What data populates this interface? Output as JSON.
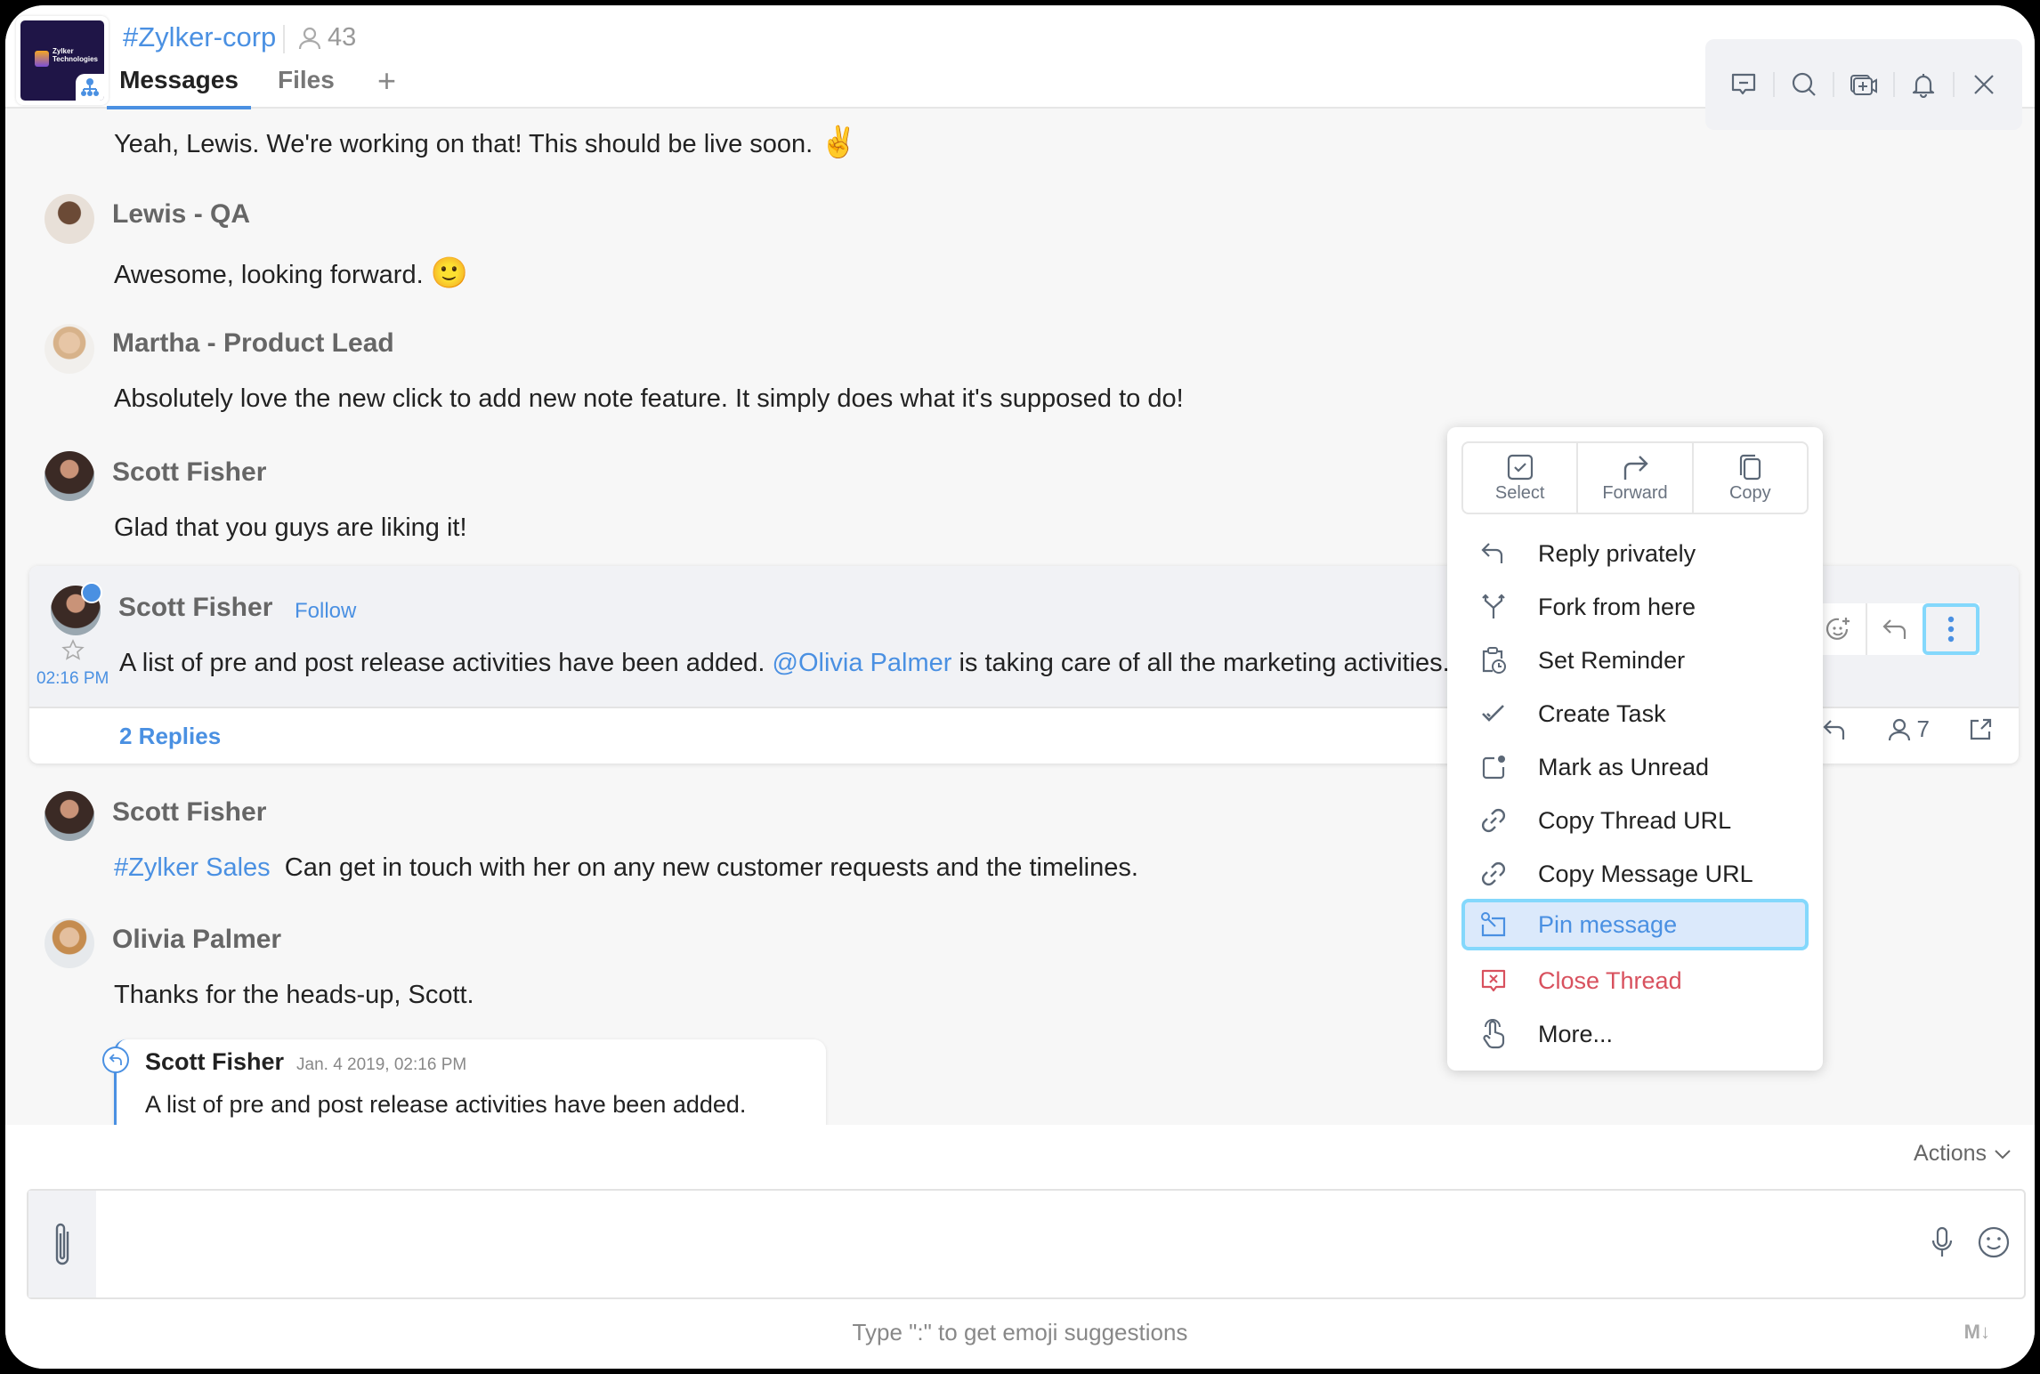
{
  "header": {
    "channel": "#Zylker-corp",
    "member_count": "43",
    "logo_text": "Zylker Technologies",
    "tabs": [
      {
        "label": "Messages",
        "active": true
      },
      {
        "label": "Files",
        "active": false
      }
    ],
    "add_tab_label": "+",
    "toolbar_icons": [
      "thread-icon",
      "search-icon",
      "add-video-icon",
      "bell-icon",
      "close-icon"
    ]
  },
  "messages": [
    {
      "author": "",
      "text": "Yeah, Lewis. We're working on that! This should be live soon.",
      "emoji": "✌️"
    },
    {
      "author": "Lewis - QA",
      "text": "Awesome, looking forward.",
      "emoji": "🙂"
    },
    {
      "author": "Martha - Product Lead",
      "text": "Absolutely love the new click to add new note feature. It simply does what it's supposed to do!"
    },
    {
      "author": "Scott Fisher",
      "text": "Glad that you guys are liking it!"
    }
  ],
  "thread": {
    "author": "Scott Fisher",
    "follow_label": "Follow",
    "time": "02:16 PM",
    "text_before": "A list of pre and post release activities have been added. ",
    "mention": "@Olivia Palmer",
    "text_after": " is taking care of all the marketing activities.",
    "replies_label": "2 Replies",
    "participants": "7"
  },
  "messages_after": [
    {
      "author": "Scott Fisher",
      "channel_link": "#Zylker Sales",
      "text": "Can get in touch with her on any new customer requests and the timelines."
    },
    {
      "author": "Olivia Palmer",
      "text": "Thanks for the heads-up, Scott."
    }
  ],
  "quote": {
    "author": "Scott Fisher",
    "date": "Jan. 4 2019, 02:16 PM",
    "text": "A list of pre and post release activities have been added."
  },
  "context_menu": {
    "top_actions": [
      {
        "label": "Select",
        "icon": "checkbox-icon"
      },
      {
        "label": "Forward",
        "icon": "forward-icon"
      },
      {
        "label": "Copy",
        "icon": "copy-icon"
      }
    ],
    "items": [
      {
        "label": "Reply privately",
        "icon": "reply-icon"
      },
      {
        "label": "Fork from here",
        "icon": "fork-icon"
      },
      {
        "label": "Set Reminder",
        "icon": "reminder-icon"
      },
      {
        "label": "Create Task",
        "icon": "task-icon"
      },
      {
        "label": "Mark as Unread",
        "icon": "unread-icon"
      },
      {
        "label": "Copy Thread URL",
        "icon": "link-icon"
      },
      {
        "label": "Copy Message URL",
        "icon": "link-icon"
      },
      {
        "label": "Pin message",
        "icon": "pin-icon",
        "highlighted": true
      },
      {
        "label": "Close Thread",
        "icon": "close-thread-icon",
        "danger": true
      },
      {
        "label": "More...",
        "icon": "hand-pointer-icon"
      }
    ]
  },
  "composer": {
    "actions_label": "Actions",
    "placeholder": "",
    "hint": "Type \":\" to get emoji suggestions",
    "markdown_label": "M↓"
  },
  "colors": {
    "accent": "#4a90e2",
    "highlight_border": "#84d8fc",
    "highlight_bg": "#dbe9fb",
    "danger": "#d8515e",
    "logo_bg": "#1f1547"
  }
}
